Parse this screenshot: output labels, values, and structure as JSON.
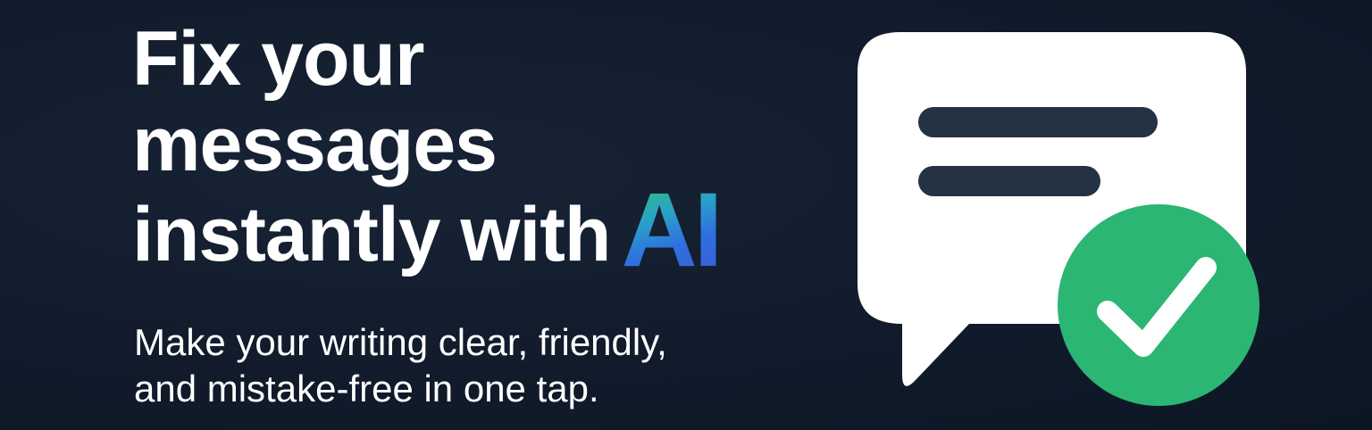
{
  "headline": {
    "line1": "Fix your",
    "line2": "messages",
    "line3": "instantly with",
    "highlight": "AI"
  },
  "subheadline": {
    "line1": "Make your writing clear, friendly,",
    "line2": "and mistake-free in one tap."
  },
  "illustration": {
    "bubble_icon": "chat-bubble-icon",
    "check_icon": "checkmark-icon",
    "colors": {
      "bubble": "#ffffff",
      "text_lines": "#243243",
      "check_circle": "#2bb673",
      "ai_gradient_start": "#31c07a",
      "ai_gradient_end": "#2f6fe0",
      "background": "#111b2b"
    }
  }
}
